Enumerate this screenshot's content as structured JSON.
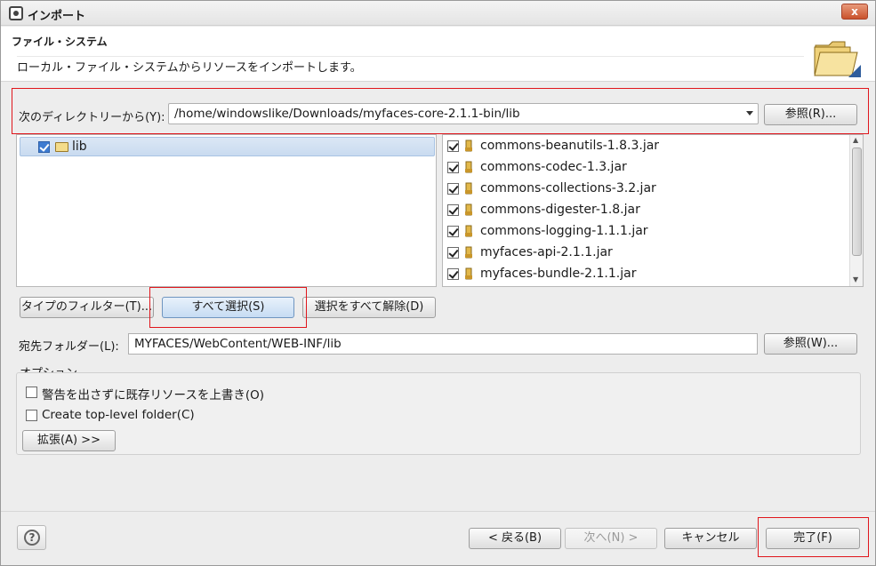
{
  "window": {
    "title": "インポート",
    "close_glyph": "x"
  },
  "header": {
    "title": "ファイル・システム",
    "description": "ローカル・ファイル・システムからリソースをインポートします。",
    "icon": "folder-icon"
  },
  "source": {
    "label": "次のディレクトリーから(Y):",
    "value": "/home/windowslike/Downloads/myfaces-core-2.1.1-bin/lib",
    "browse_label": "参照(R)..."
  },
  "folder_tree": {
    "items": [
      {
        "label": "lib",
        "checked": true
      }
    ]
  },
  "file_list": {
    "items": [
      {
        "name": "commons-beanutils-1.8.3.jar",
        "checked": true
      },
      {
        "name": "commons-codec-1.3.jar",
        "checked": true
      },
      {
        "name": "commons-collections-3.2.jar",
        "checked": true
      },
      {
        "name": "commons-digester-1.8.jar",
        "checked": true
      },
      {
        "name": "commons-logging-1.1.1.jar",
        "checked": true
      },
      {
        "name": "myfaces-api-2.1.1.jar",
        "checked": true
      },
      {
        "name": "myfaces-bundle-2.1.1.jar",
        "checked": true
      }
    ]
  },
  "selection_buttons": {
    "filter": "タイプのフィルター(T)...",
    "select_all": "すべて選択(S)",
    "deselect_all": "選択をすべて解除(D)"
  },
  "destination": {
    "label": "宛先フォルダー(L):",
    "value": "MYFACES/WebContent/WEB-INF/lib",
    "browse_label": "参照(W)..."
  },
  "options": {
    "group_label": "オプション",
    "overwrite_label": "警告を出さずに既存リソースを上書き(O)",
    "overwrite_checked": false,
    "create_folder_label": "Create top-level folder(C)",
    "create_folder_checked": false,
    "advanced_label": "拡張(A) >>"
  },
  "footer": {
    "back": "< 戻る(B)",
    "next": "次へ(N) >",
    "cancel": "キャンセル",
    "finish": "完了(F)",
    "help_glyph": "?"
  },
  "colors": {
    "annotation_red": "#e0161c",
    "selection_blue": "#c9dbf0"
  }
}
